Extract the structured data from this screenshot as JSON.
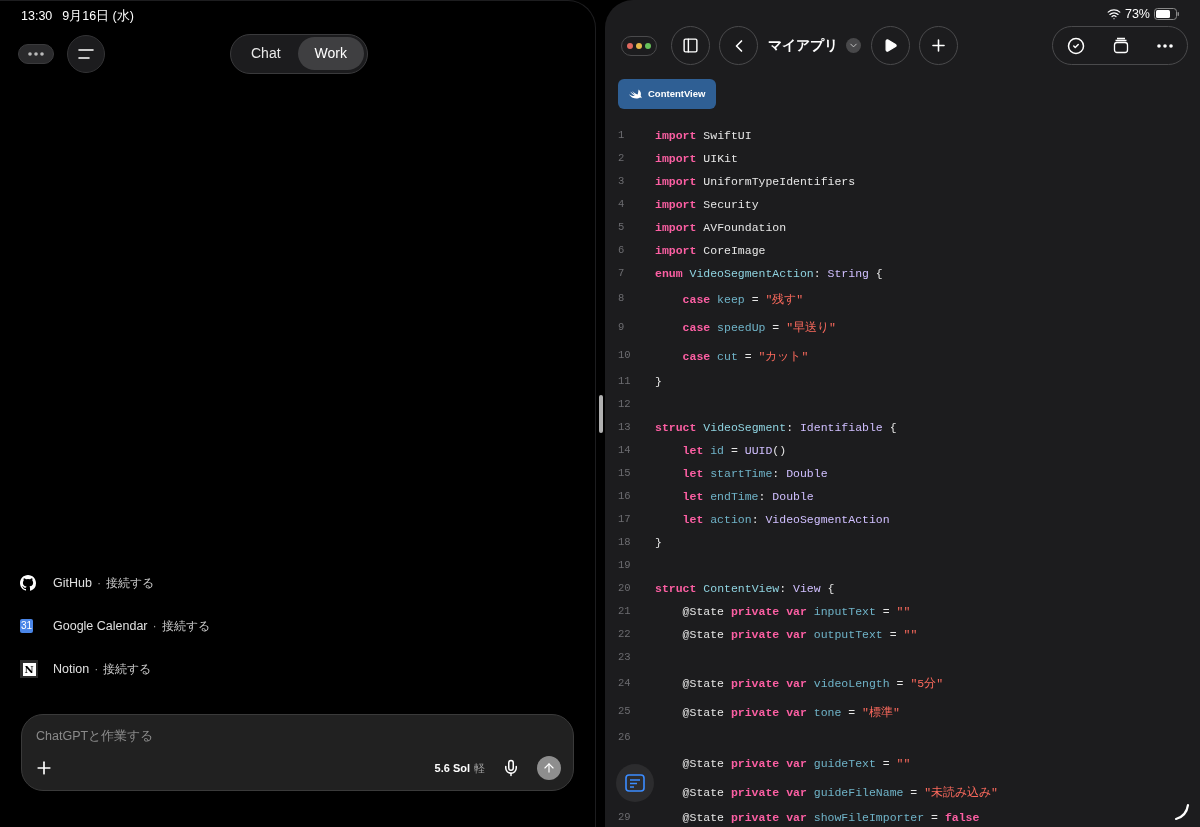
{
  "status_bar": {
    "time": "13:30",
    "date": "9月16日 (水)",
    "battery": "73%"
  },
  "left_pane": {
    "segments": [
      {
        "label": "Chat",
        "selected": false
      },
      {
        "label": "Work",
        "selected": true
      }
    ],
    "integrations": [
      {
        "kind": "github",
        "name": "GitHub",
        "separator": "·",
        "action": "接続する"
      },
      {
        "kind": "calendar",
        "icon_text": "31",
        "name": "Google Calendar",
        "separator": "·",
        "action": "接続する"
      },
      {
        "kind": "notion",
        "icon_text": "N",
        "name": "Notion",
        "separator": "·",
        "action": "接続する"
      }
    ],
    "composer": {
      "placeholder": "ChatGPTと作業する",
      "model": "5.6 Sol",
      "mode": "軽"
    }
  },
  "editor": {
    "title": "マイアプリ",
    "file_tab": "ContentView",
    "lines": [
      {
        "number": "1",
        "tokens": [
          {
            "kind": "keyword",
            "text": "import"
          },
          {
            "kind": "plain",
            "text": " SwiftUI"
          }
        ]
      },
      {
        "number": "2",
        "tokens": [
          {
            "kind": "keyword",
            "text": "import"
          },
          {
            "kind": "plain",
            "text": " UIKit"
          }
        ]
      },
      {
        "number": "3",
        "tokens": [
          {
            "kind": "keyword",
            "text": "import"
          },
          {
            "kind": "plain",
            "text": " UniformTypeIdentifiers"
          }
        ]
      },
      {
        "number": "4",
        "tokens": [
          {
            "kind": "keyword",
            "text": "import"
          },
          {
            "kind": "plain",
            "text": " Security"
          }
        ]
      },
      {
        "number": "5",
        "tokens": [
          {
            "kind": "keyword",
            "text": "import"
          },
          {
            "kind": "plain",
            "text": " AVFoundation"
          }
        ]
      },
      {
        "number": "6",
        "tokens": [
          {
            "kind": "keyword",
            "text": "import"
          },
          {
            "kind": "plain",
            "text": " CoreImage"
          }
        ]
      },
      {
        "number": "7",
        "tokens": [
          {
            "kind": "keyword",
            "text": "enum"
          },
          {
            "kind": "declaration",
            "text": " VideoSegmentAction"
          },
          {
            "kind": "plain",
            "text": ": "
          },
          {
            "kind": "type",
            "text": "String"
          },
          {
            "kind": "plain",
            "text": " {"
          }
        ]
      },
      {
        "number": "8",
        "spaced": true,
        "tokens": [
          {
            "kind": "keyword",
            "text": "    case"
          },
          {
            "kind": "property",
            "text": " keep"
          },
          {
            "kind": "plain",
            "text": " = "
          },
          {
            "kind": "string",
            "text": "\"残す\""
          }
        ]
      },
      {
        "number": "9",
        "spaced": true,
        "tokens": [
          {
            "kind": "keyword",
            "text": "    case"
          },
          {
            "kind": "property",
            "text": " speedUp"
          },
          {
            "kind": "plain",
            "text": " = "
          },
          {
            "kind": "string",
            "text": "\"早送り\""
          }
        ]
      },
      {
        "number": "10",
        "spaced": true,
        "tokens": [
          {
            "kind": "keyword",
            "text": "    case"
          },
          {
            "kind": "property",
            "text": " cut"
          },
          {
            "kind": "plain",
            "text": " = "
          },
          {
            "kind": "string",
            "text": "\"カット\""
          }
        ]
      },
      {
        "number": "11",
        "tokens": [
          {
            "kind": "plain",
            "text": "}"
          }
        ]
      },
      {
        "number": "12"
      },
      {
        "number": "13",
        "tokens": [
          {
            "kind": "keyword",
            "text": "struct"
          },
          {
            "kind": "declaration",
            "text": " VideoSegment"
          },
          {
            "kind": "plain",
            "text": ": "
          },
          {
            "kind": "type",
            "text": "Identifiable"
          },
          {
            "kind": "plain",
            "text": " {"
          }
        ]
      },
      {
        "number": "14",
        "tokens": [
          {
            "kind": "keyword",
            "text": "    let"
          },
          {
            "kind": "property",
            "text": " id"
          },
          {
            "kind": "plain",
            "text": " = "
          },
          {
            "kind": "type",
            "text": "UUID"
          },
          {
            "kind": "plain",
            "text": "()"
          }
        ]
      },
      {
        "number": "15",
        "tokens": [
          {
            "kind": "keyword",
            "text": "    let"
          },
          {
            "kind": "property",
            "text": " startTime"
          },
          {
            "kind": "plain",
            "text": ": "
          },
          {
            "kind": "type",
            "text": "Double"
          }
        ]
      },
      {
        "number": "16",
        "tokens": [
          {
            "kind": "keyword",
            "text": "    let"
          },
          {
            "kind": "property",
            "text": " endTime"
          },
          {
            "kind": "plain",
            "text": ": "
          },
          {
            "kind": "type",
            "text": "Double"
          }
        ]
      },
      {
        "number": "17",
        "tokens": [
          {
            "kind": "keyword",
            "text": "    let"
          },
          {
            "kind": "property",
            "text": " action"
          },
          {
            "kind": "plain",
            "text": ": "
          },
          {
            "kind": "type",
            "text": "VideoSegmentAction"
          }
        ]
      },
      {
        "number": "18",
        "tokens": [
          {
            "kind": "plain",
            "text": "}"
          }
        ]
      },
      {
        "number": "19"
      },
      {
        "number": "20",
        "tokens": [
          {
            "kind": "keyword",
            "text": "struct"
          },
          {
            "kind": "declaration",
            "text": " ContentView"
          },
          {
            "kind": "plain",
            "text": ": "
          },
          {
            "kind": "type",
            "text": "View"
          },
          {
            "kind": "plain",
            "text": " {"
          }
        ]
      },
      {
        "number": "21",
        "tokens": [
          {
            "kind": "plain",
            "text": "    @State"
          },
          {
            "kind": "keyword",
            "text": " private var"
          },
          {
            "kind": "property",
            "text": " inputText"
          },
          {
            "kind": "plain",
            "text": " = "
          },
          {
            "kind": "string",
            "text": "\"\""
          }
        ]
      },
      {
        "number": "22",
        "tokens": [
          {
            "kind": "plain",
            "text": "    @State"
          },
          {
            "kind": "keyword",
            "text": " private var"
          },
          {
            "kind": "property",
            "text": " outputText"
          },
          {
            "kind": "plain",
            "text": " = "
          },
          {
            "kind": "string",
            "text": "\"\""
          }
        ]
      },
      {
        "number": "23"
      },
      {
        "number": "24",
        "spaced": true,
        "tokens": [
          {
            "kind": "plain",
            "text": "    @State"
          },
          {
            "kind": "keyword",
            "text": " private var"
          },
          {
            "kind": "property",
            "text": " videoLength"
          },
          {
            "kind": "plain",
            "text": " = "
          },
          {
            "kind": "string",
            "text": "\"5分\""
          }
        ]
      },
      {
        "number": "25",
        "spaced": true,
        "tokens": [
          {
            "kind": "plain",
            "text": "    @State"
          },
          {
            "kind": "keyword",
            "text": " private var"
          },
          {
            "kind": "property",
            "text": " tone"
          },
          {
            "kind": "plain",
            "text": " = "
          },
          {
            "kind": "string",
            "text": "\"標準\""
          }
        ]
      },
      {
        "number": "26"
      },
      {
        "spaced": true,
        "tokens": [
          {
            "kind": "plain",
            "text": "    @State"
          },
          {
            "kind": "keyword",
            "text": " private var"
          },
          {
            "kind": "property",
            "text": " guideText"
          },
          {
            "kind": "plain",
            "text": " = "
          },
          {
            "kind": "string",
            "text": "\"\""
          }
        ]
      },
      {
        "spaced": true,
        "tokens": [
          {
            "kind": "plain",
            "text": "    @State"
          },
          {
            "kind": "keyword",
            "text": " private var"
          },
          {
            "kind": "property",
            "text": " guideFileName"
          },
          {
            "kind": "plain",
            "text": " = "
          },
          {
            "kind": "string",
            "text": "\"未読み込み\""
          }
        ]
      },
      {
        "number": "29",
        "tokens": [
          {
            "kind": "plain",
            "text": "    @State"
          },
          {
            "kind": "keyword",
            "text": " private var"
          },
          {
            "kind": "property",
            "text": " showFileImporter"
          },
          {
            "kind": "plain",
            "text": " = "
          },
          {
            "kind": "keyword",
            "text": "false"
          }
        ]
      }
    ]
  }
}
